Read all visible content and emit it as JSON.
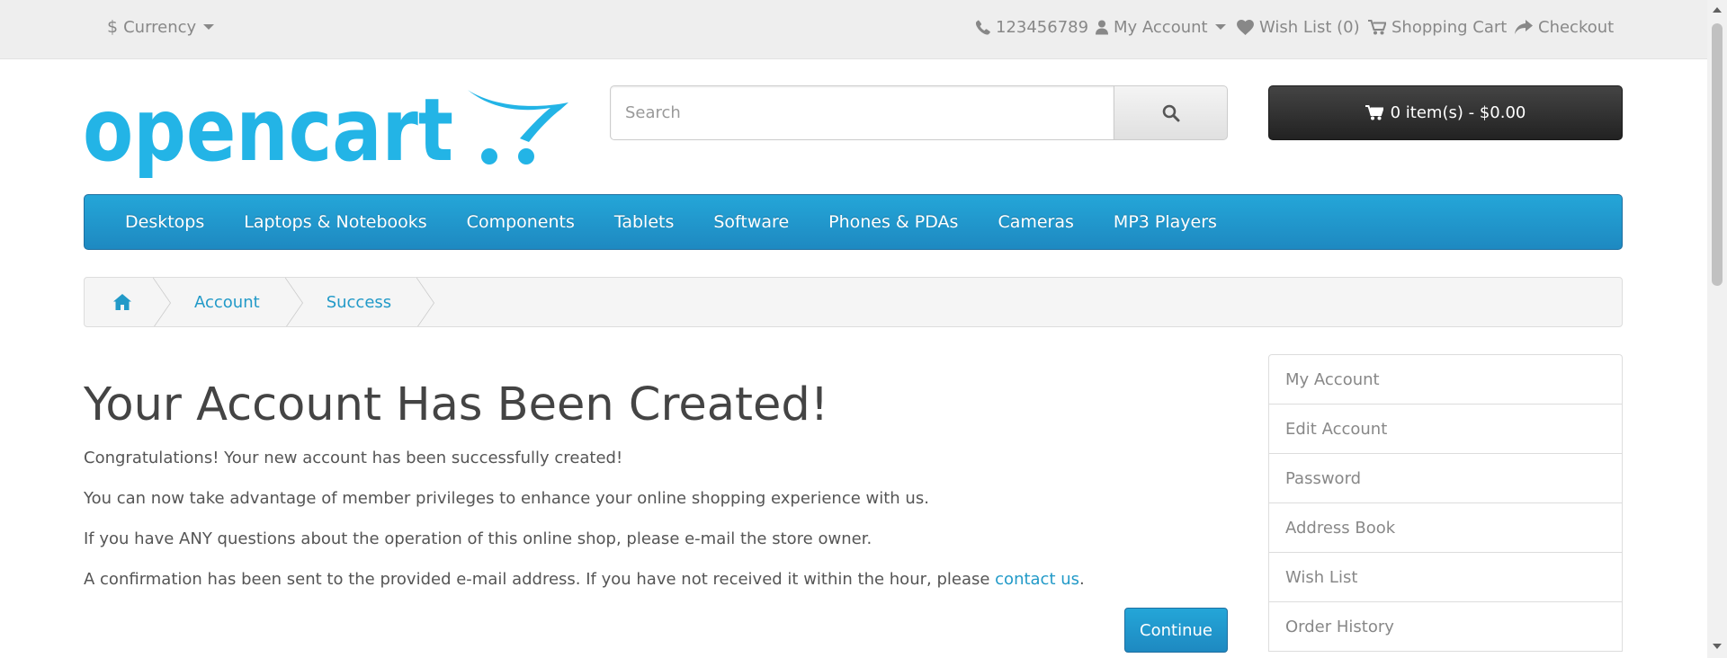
{
  "topbar": {
    "currency_label": "Currency",
    "phone": "123456789",
    "my_account": "My Account",
    "wishlist": "Wish List (0)",
    "shopping_cart": "Shopping Cart",
    "checkout": "Checkout"
  },
  "header": {
    "logo_text": "opencart",
    "search_placeholder": "Search",
    "cart_summary": "0 item(s) - $0.00"
  },
  "menu": {
    "items": [
      "Desktops",
      "Laptops & Notebooks",
      "Components",
      "Tablets",
      "Software",
      "Phones & PDAs",
      "Cameras",
      "MP3 Players"
    ]
  },
  "breadcrumb": {
    "items": [
      "Account",
      "Success"
    ]
  },
  "content": {
    "title": "Your Account Has Been Created!",
    "p1": "Congratulations! Your new account has been successfully created!",
    "p2": "You can now take advantage of member privileges to enhance your online shopping experience with us.",
    "p3": "If you have ANY questions about the operation of this online shop, please e-mail the store owner.",
    "p4_text": "A confirmation has been sent to the provided e-mail address. If you have not received it within the hour, please ",
    "p4_link": "contact us",
    "p4_end": ".",
    "continue": "Continue"
  },
  "sidebar": {
    "items": [
      "My Account",
      "Edit Account",
      "Password",
      "Address Book",
      "Wish List",
      "Order History"
    ]
  },
  "colors": {
    "accent": "#229ac8",
    "menu": "#1e91cf",
    "cart_button": "#303030",
    "topbar_bg": "#eeeeee"
  }
}
